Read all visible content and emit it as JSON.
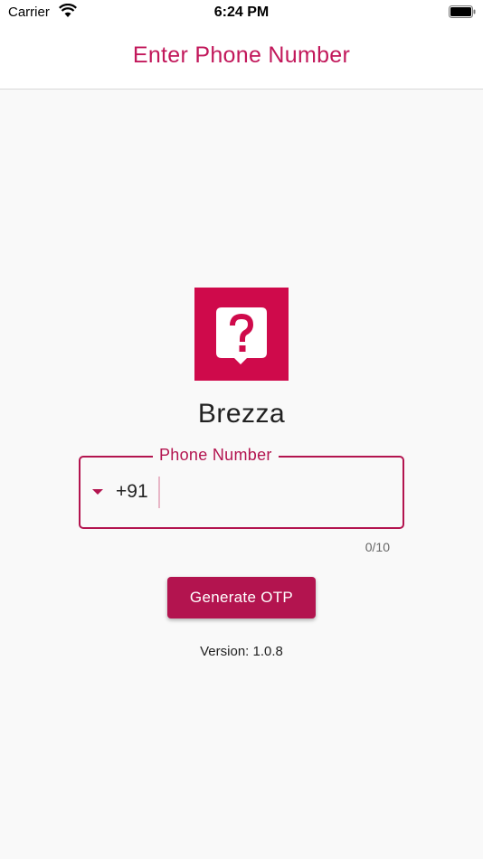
{
  "status_bar": {
    "carrier": "Carrier",
    "time": "6:24 PM",
    "icons": [
      "wifi-icon",
      "battery-icon"
    ]
  },
  "app_bar": {
    "title": "Enter Phone Number"
  },
  "logo": {
    "icon": "question-bubble-icon",
    "color": "#cf0a4b"
  },
  "app_name": "Brezza",
  "phone_field": {
    "label": "Phone Number",
    "country_code": "+91",
    "value": "",
    "counter": "0/10"
  },
  "otp_button": {
    "label": "Generate OTP"
  },
  "version": "Version: 1.0.8",
  "colors": {
    "accent": "#b3144f",
    "title": "#c2185b",
    "logo_bg": "#cf0a4b",
    "background": "#f9f9f9"
  }
}
